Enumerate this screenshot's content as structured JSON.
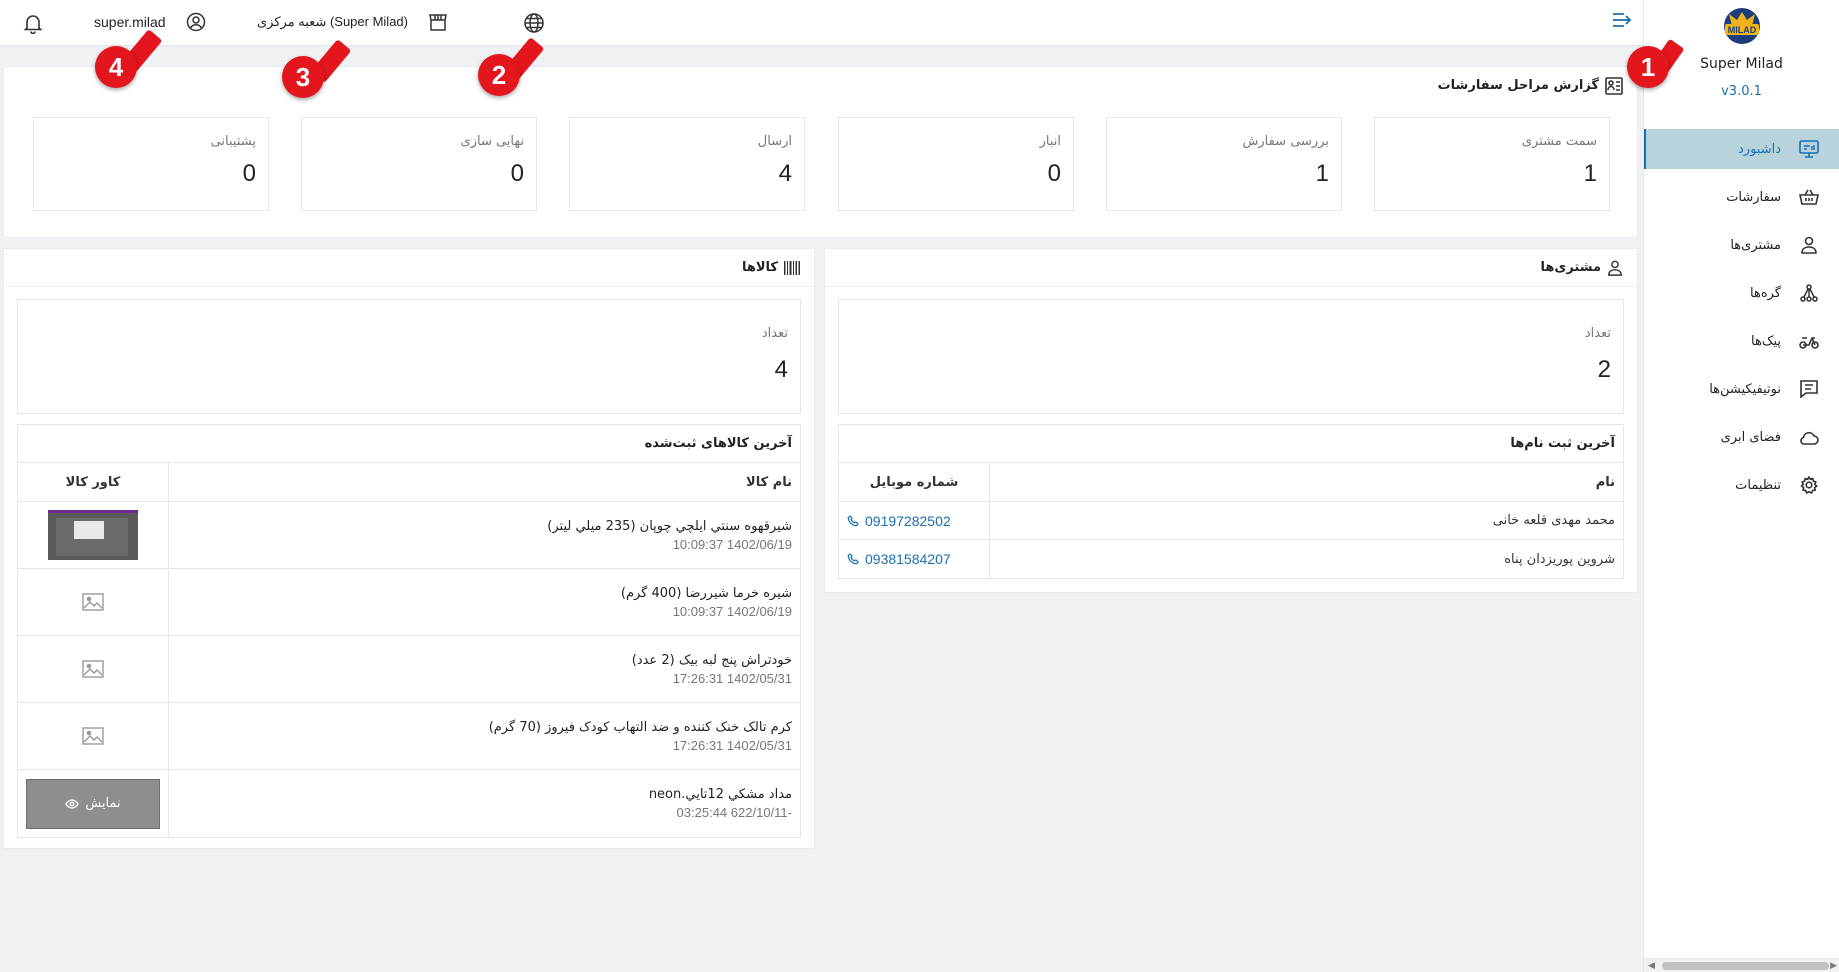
{
  "sidebar": {
    "brand_name": "Super Milad",
    "version": "v3.0.1",
    "items": [
      {
        "label": "داشبورد",
        "icon": "dashboard-icon"
      },
      {
        "label": "سفارشات",
        "icon": "basket-icon"
      },
      {
        "label": "مشتری‌ها",
        "icon": "user-icon"
      },
      {
        "label": "گره‌ها",
        "icon": "nodes-icon"
      },
      {
        "label": "پیک‌ها",
        "icon": "scooter-icon"
      },
      {
        "label": "نوتیفیکیشن‌ها",
        "icon": "message-icon"
      },
      {
        "label": "فضای ابری",
        "icon": "cloud-icon"
      },
      {
        "label": "تنظیمات",
        "icon": "gear-icon"
      }
    ]
  },
  "topbar": {
    "username": "super.milad",
    "branch": "شعبه مرکزی (Super Milad)"
  },
  "callouts": [
    "1",
    "2",
    "3",
    "4"
  ],
  "orders_report": {
    "title": "گزارش مراحل سفارشات",
    "stages": [
      {
        "label": "سمت مشتری",
        "value": "1"
      },
      {
        "label": "بررسی سفارش",
        "value": "1"
      },
      {
        "label": "انبار",
        "value": "0"
      },
      {
        "label": "ارسال",
        "value": "4"
      },
      {
        "label": "نهایی سازی",
        "value": "0"
      },
      {
        "label": "پشتیبانی",
        "value": "0"
      }
    ]
  },
  "customers": {
    "title": "مشتری‌ها",
    "count_label": "تعداد",
    "count": "2",
    "recent_title": "آخرین ثبت نام‌ها",
    "col_name": "نام",
    "col_phone": "شماره موبایل",
    "rows": [
      {
        "name": "محمد مهدی قلعه خانی",
        "phone": "09197282502"
      },
      {
        "name": "شروین پوریزدان پناه",
        "phone": "09381584207"
      }
    ]
  },
  "products": {
    "title": "کالاها",
    "count_label": "تعداد",
    "count": "4",
    "recent_title": "آخرین کالاهای ثبت‌شده",
    "col_name": "نام کالا",
    "col_cover": "کاور کالا",
    "show_label": "نمایش",
    "rows": [
      {
        "name": "شيرقهوه سنتي ايلچي چوپان (235 ميلي ليتر)",
        "date": "1402/06/19 10:09:37",
        "cover": "photo"
      },
      {
        "name": "شیره خرما شیررضا (400 گرم)",
        "date": "1402/06/19 10:09:37",
        "cover": "placeholder"
      },
      {
        "name": "خودتراش پنج لبه بیک (2 عدد)",
        "date": "1402/05/31 17:26:31",
        "cover": "placeholder"
      },
      {
        "name": "کرم تالک خنک کننده و ضد التهاب کودک فیروز (70 گرم)",
        "date": "1402/05/31 17:26:31",
        "cover": "placeholder"
      },
      {
        "name": "مداد مشكي 12تايي.neon",
        "date": "-622/10/11 03:25:44",
        "cover": "button"
      }
    ]
  },
  "colors": {
    "accent": "#1a6fb0",
    "active_bg": "#b9d3dd",
    "callout": "#e4161d"
  }
}
